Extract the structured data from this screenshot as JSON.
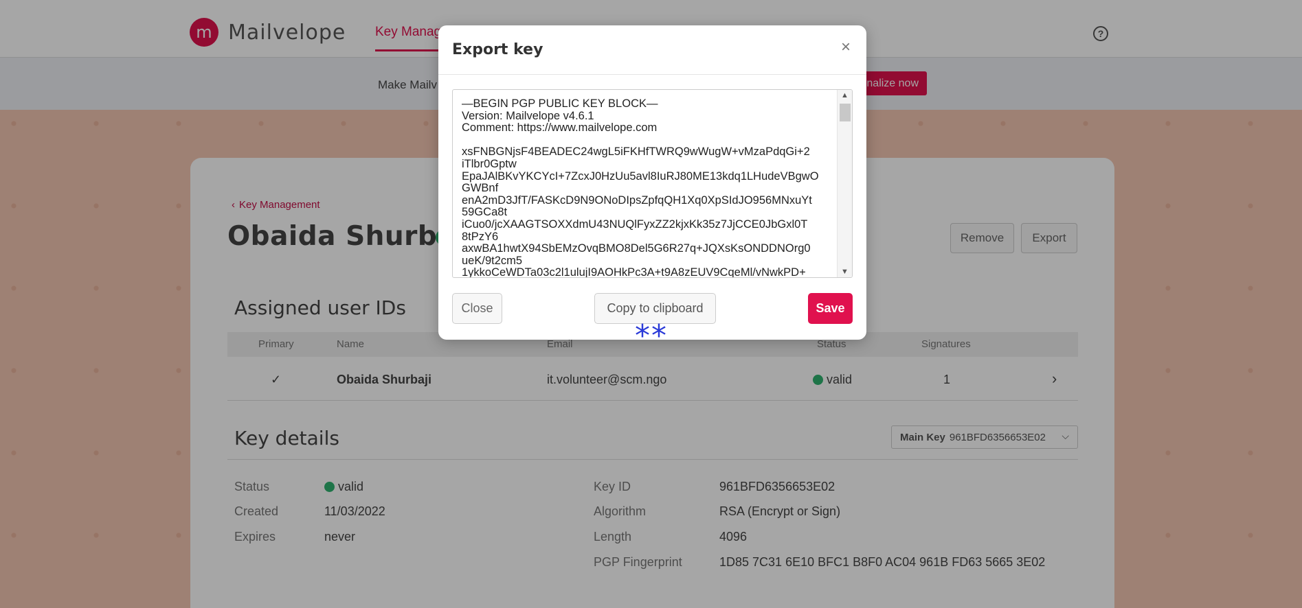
{
  "app": {
    "logo_text": "Mailvelope",
    "nav_tab": "Key Manag",
    "help_icon": "?",
    "banner_text": "Make Mailv",
    "banner_button": "nalize now"
  },
  "page": {
    "back_link": "Key Management",
    "title": "Obaida Shurbaji",
    "remove_label": "Remove",
    "export_label": "Export"
  },
  "user_ids": {
    "section_title": "Assigned user IDs",
    "columns": [
      "Primary",
      "Name",
      "Email",
      "Status",
      "Signatures"
    ],
    "row": {
      "primary": "✓",
      "name": "Obaida Shurbaji",
      "email": "it.volunteer@scm.ngo",
      "status": "valid",
      "signatures": "1"
    }
  },
  "key_details": {
    "section_title": "Key details",
    "select_label": "Main Key",
    "select_value": "961BFD6356653E02",
    "status_label": "Status",
    "status_value": "valid",
    "created_label": "Created",
    "created_value": "11/03/2022",
    "expires_label": "Expires",
    "expires_value": "never",
    "keyid_label": "Key ID",
    "keyid_value": "961BFD6356653E02",
    "algorithm_label": "Algorithm",
    "algorithm_value": "RSA (Encrypt or Sign)",
    "length_label": "Length",
    "length_value": "4096",
    "fingerprint_label": "PGP Fingerprint",
    "fingerprint_value": "1D85 7C31 6E10 BFC1 B8F0 AC04 961B FD63 5665 3E02"
  },
  "modal": {
    "title": "Export key",
    "close_icon": "×",
    "key_text": "—BEGIN PGP PUBLIC KEY BLOCK—\nVersion: Mailvelope v4.6.1\nComment: https://www.mailvelope.com\n\nxsFNBGNjsF4BEADEC24wgL5iFKHfTWRQ9wWugW+vMzaPdqGi+2\niTlbr0Gptw\nEpaJAlBKvYKCYcI+7ZcxJ0HzUu5avl8IuRJ80ME13kdq1LHudeVBgwO\nGWBnf\nenA2mD3JfT/FASKcD9N9ONoDIpsZpfqQH1Xq0XpSIdJO956MNxuYt\n59GCa8t\niCuo0/jcXAAGTSOXXdmU43NUQlFyxZZ2kjxKk35z7JjCCE0JbGxl0T\n8tPzY6\naxwBA1hwtX94SbEMzOvqBMO8Del5G6R27q+JQXsKsONDDNOrg0\nueK/9t2cm5\n1ykkoCeWDTa03c2l1ulujI9AOHkPc3A+t9A8zEUV9CqeMl/vNwkPD+",
    "close_button": "Close",
    "copy_button": "Copy to clipboard",
    "save_button": "Save",
    "copy_feedback": "**"
  }
}
